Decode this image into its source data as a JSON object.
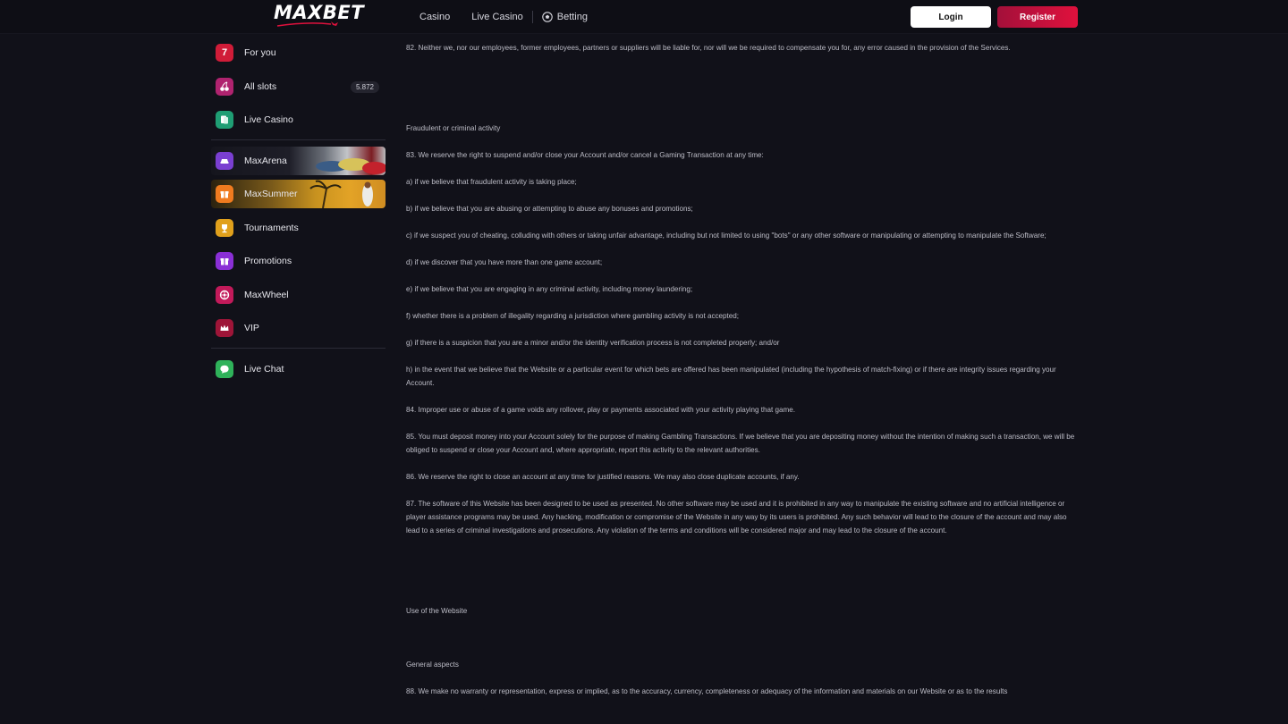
{
  "header": {
    "logo_text": "MAXBET",
    "nav": {
      "casino": "Casino",
      "live_casino": "Live Casino",
      "betting": "Betting"
    },
    "login_label": "Login",
    "register_label": "Register"
  },
  "sidebar": {
    "items": [
      {
        "label": "For you",
        "icon": "seven-icon"
      },
      {
        "label": "All slots",
        "icon": "cherry-icon",
        "badge": "5.872"
      },
      {
        "label": "Live Casino",
        "icon": "cards-icon"
      },
      {
        "label": "MaxArena",
        "icon": "car-icon"
      },
      {
        "label": "MaxSummer",
        "icon": "gift-box-icon"
      },
      {
        "label": "Tournaments",
        "icon": "trophy-icon"
      },
      {
        "label": "Promotions",
        "icon": "gift-icon"
      },
      {
        "label": "MaxWheel",
        "icon": "wheel-icon"
      },
      {
        "label": "VIP",
        "icon": "crown-icon"
      },
      {
        "label": "Live Chat",
        "icon": "chat-icon"
      }
    ]
  },
  "content": {
    "p82": "82. Neither we, nor our employees, former employees, partners or suppliers will be liable for, nor will we be required to compensate you for, any error caused in the provision of the Services.",
    "heading_fraud": "Fraudulent or criminal activity",
    "p83": "83. We reserve the right to suspend and/or close your Account and/or cancel a Gaming Transaction at any time:",
    "p83a": "a) if we believe that fraudulent activity is taking place;",
    "p83b": "b) if we believe that you are abusing or attempting to abuse any bonuses and promotions;",
    "p83c": "c) if we suspect you of cheating, colluding with others or taking unfair advantage, including but not limited to using \"bots\" or any other software or manipulating or attempting to manipulate the Software;",
    "p83d": "d) if we discover that you have more than one game account;",
    "p83e": "e) if we believe that you are engaging in any criminal activity, including money laundering;",
    "p83f": "f) whether there is a problem of illegality regarding a jurisdiction where gambling activity is not accepted;",
    "p83g": "g) if there is a suspicion that you are a minor and/or the identity verification process is not completed properly; and/or",
    "p83h": "h) in the event that we believe that the Website or a particular event for which bets are offered has been manipulated (including the hypothesis of match-fixing) or if there are integrity issues regarding your Account.",
    "p84": "84. Improper use or abuse of a game voids any rollover, play or payments associated with your activity playing that game.",
    "p85": "85. You must deposit money into your Account solely for the purpose of making Gambling Transactions. If we believe that you are depositing money without the intention of making such a transaction, we will be obliged to suspend or close your Account and, where appropriate, report this activity to the relevant authorities.",
    "p86": "86. We reserve the right to close an account at any time for justified reasons. We may also close duplicate accounts, if any.",
    "p87": "87. The software of this Website has been designed to be used as presented. No other software may be used and it is prohibited in any way to manipulate the existing software and no artificial intelligence or player assistance programs may be used. Any hacking, modification or compromise of the Website in any way by its users is prohibited. Any such behavior will lead to the closure of the account and may also lead to a series of criminal investigations and prosecutions. Any violation of the terms and conditions will be considered major and may lead to the closure of the account.",
    "heading_use": "Use of the Website",
    "heading_general": "General aspects",
    "p88": "88. We make no warranty or representation, express or implied, as to the accuracy, currency, completeness or adequacy of the information and materials on our Website or as to the results"
  },
  "colors": {
    "background": "#111119",
    "header_bg": "#0e0e15",
    "register_red": "#e0113d",
    "login_white": "#ffffff"
  }
}
